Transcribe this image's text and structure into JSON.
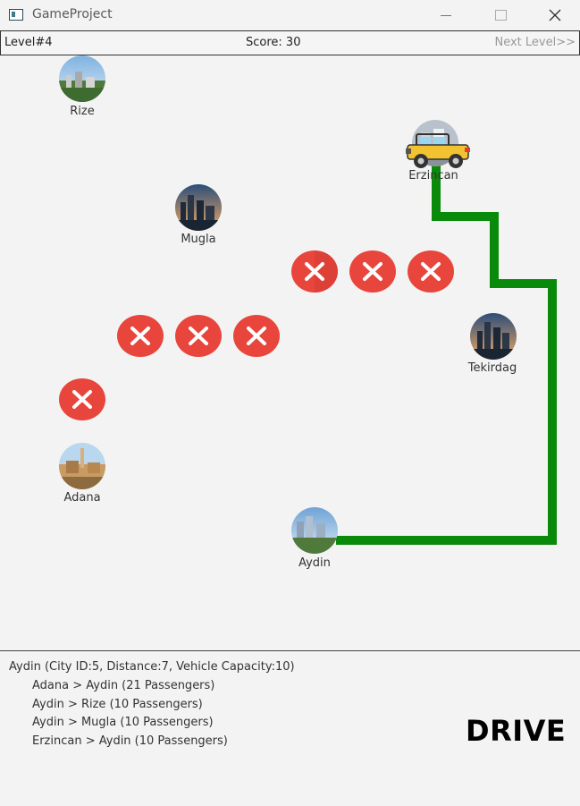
{
  "window": {
    "title": "GameProject"
  },
  "header": {
    "level": "Level#4",
    "score": "Score: 30",
    "next_level": "Next Level>>"
  },
  "cities": [
    {
      "id": "rize",
      "name": "Rize"
    },
    {
      "id": "erzincan",
      "name": "Erzincan"
    },
    {
      "id": "mugla",
      "name": "Mugla"
    },
    {
      "id": "tekirdag",
      "name": "Tekirdag"
    },
    {
      "id": "adana",
      "name": "Adana"
    },
    {
      "id": "aydin",
      "name": "Aydin"
    }
  ],
  "blockers_count": 7,
  "route_color": "#0a8a0a",
  "blocker_color": "#e8453c",
  "info": {
    "header": "Aydin (City ID:5, Distance:7, Vehicle Capacity:10)",
    "routes": [
      "Adana > Aydin (21 Passengers)",
      "Aydin > Rize (10 Passengers)",
      "Aydin > Mugla (10 Passengers)",
      "Erzincan > Aydin (10 Passengers)"
    ],
    "drive_label": "DRIVE"
  }
}
